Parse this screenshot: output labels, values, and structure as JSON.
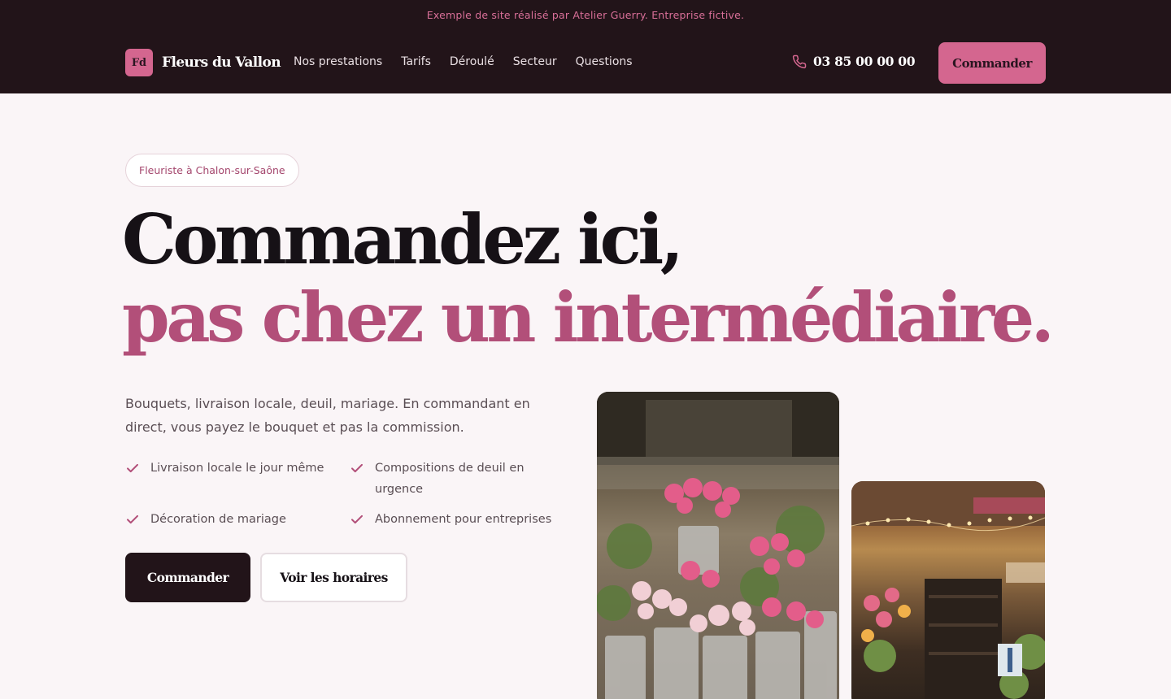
{
  "header": {
    "notice": "Exemple de site réalisé par Atelier Guerry. Entreprise fictive.",
    "brand_mark": "Fd",
    "brand_name": "Fleurs du Vallon",
    "nav": [
      "Nos prestations",
      "Tarifs",
      "Déroulé",
      "Secteur",
      "Questions"
    ],
    "phone": "03 85 00 00 00",
    "cta": "Commander"
  },
  "hero": {
    "badge": "Fleuriste à Chalon-sur-Saône",
    "headline_line1": "Commandez ici,",
    "headline_line2": "pas chez un intermédiaire.",
    "lead": "Bouquets, livraison locale, deuil, mariage. En commandant en direct, vous payez le bouquet et pas la commission.",
    "features": [
      "Livraison locale le jour même",
      "Compositions de deuil en urgence",
      "Décoration de mariage",
      "Abonnement pour entreprises"
    ],
    "primary_button": "Commander",
    "secondary_button": "Voir les horaires"
  },
  "colors": {
    "header_bg": "#221419",
    "accent": "#d4668f",
    "headline_accent": "#b24f79",
    "page_bg": "#faf5f7"
  },
  "icons": {
    "phone": "phone-icon",
    "check": "check-icon"
  },
  "photos": [
    "flower-buckets-photo",
    "flower-shop-interior-photo"
  ]
}
